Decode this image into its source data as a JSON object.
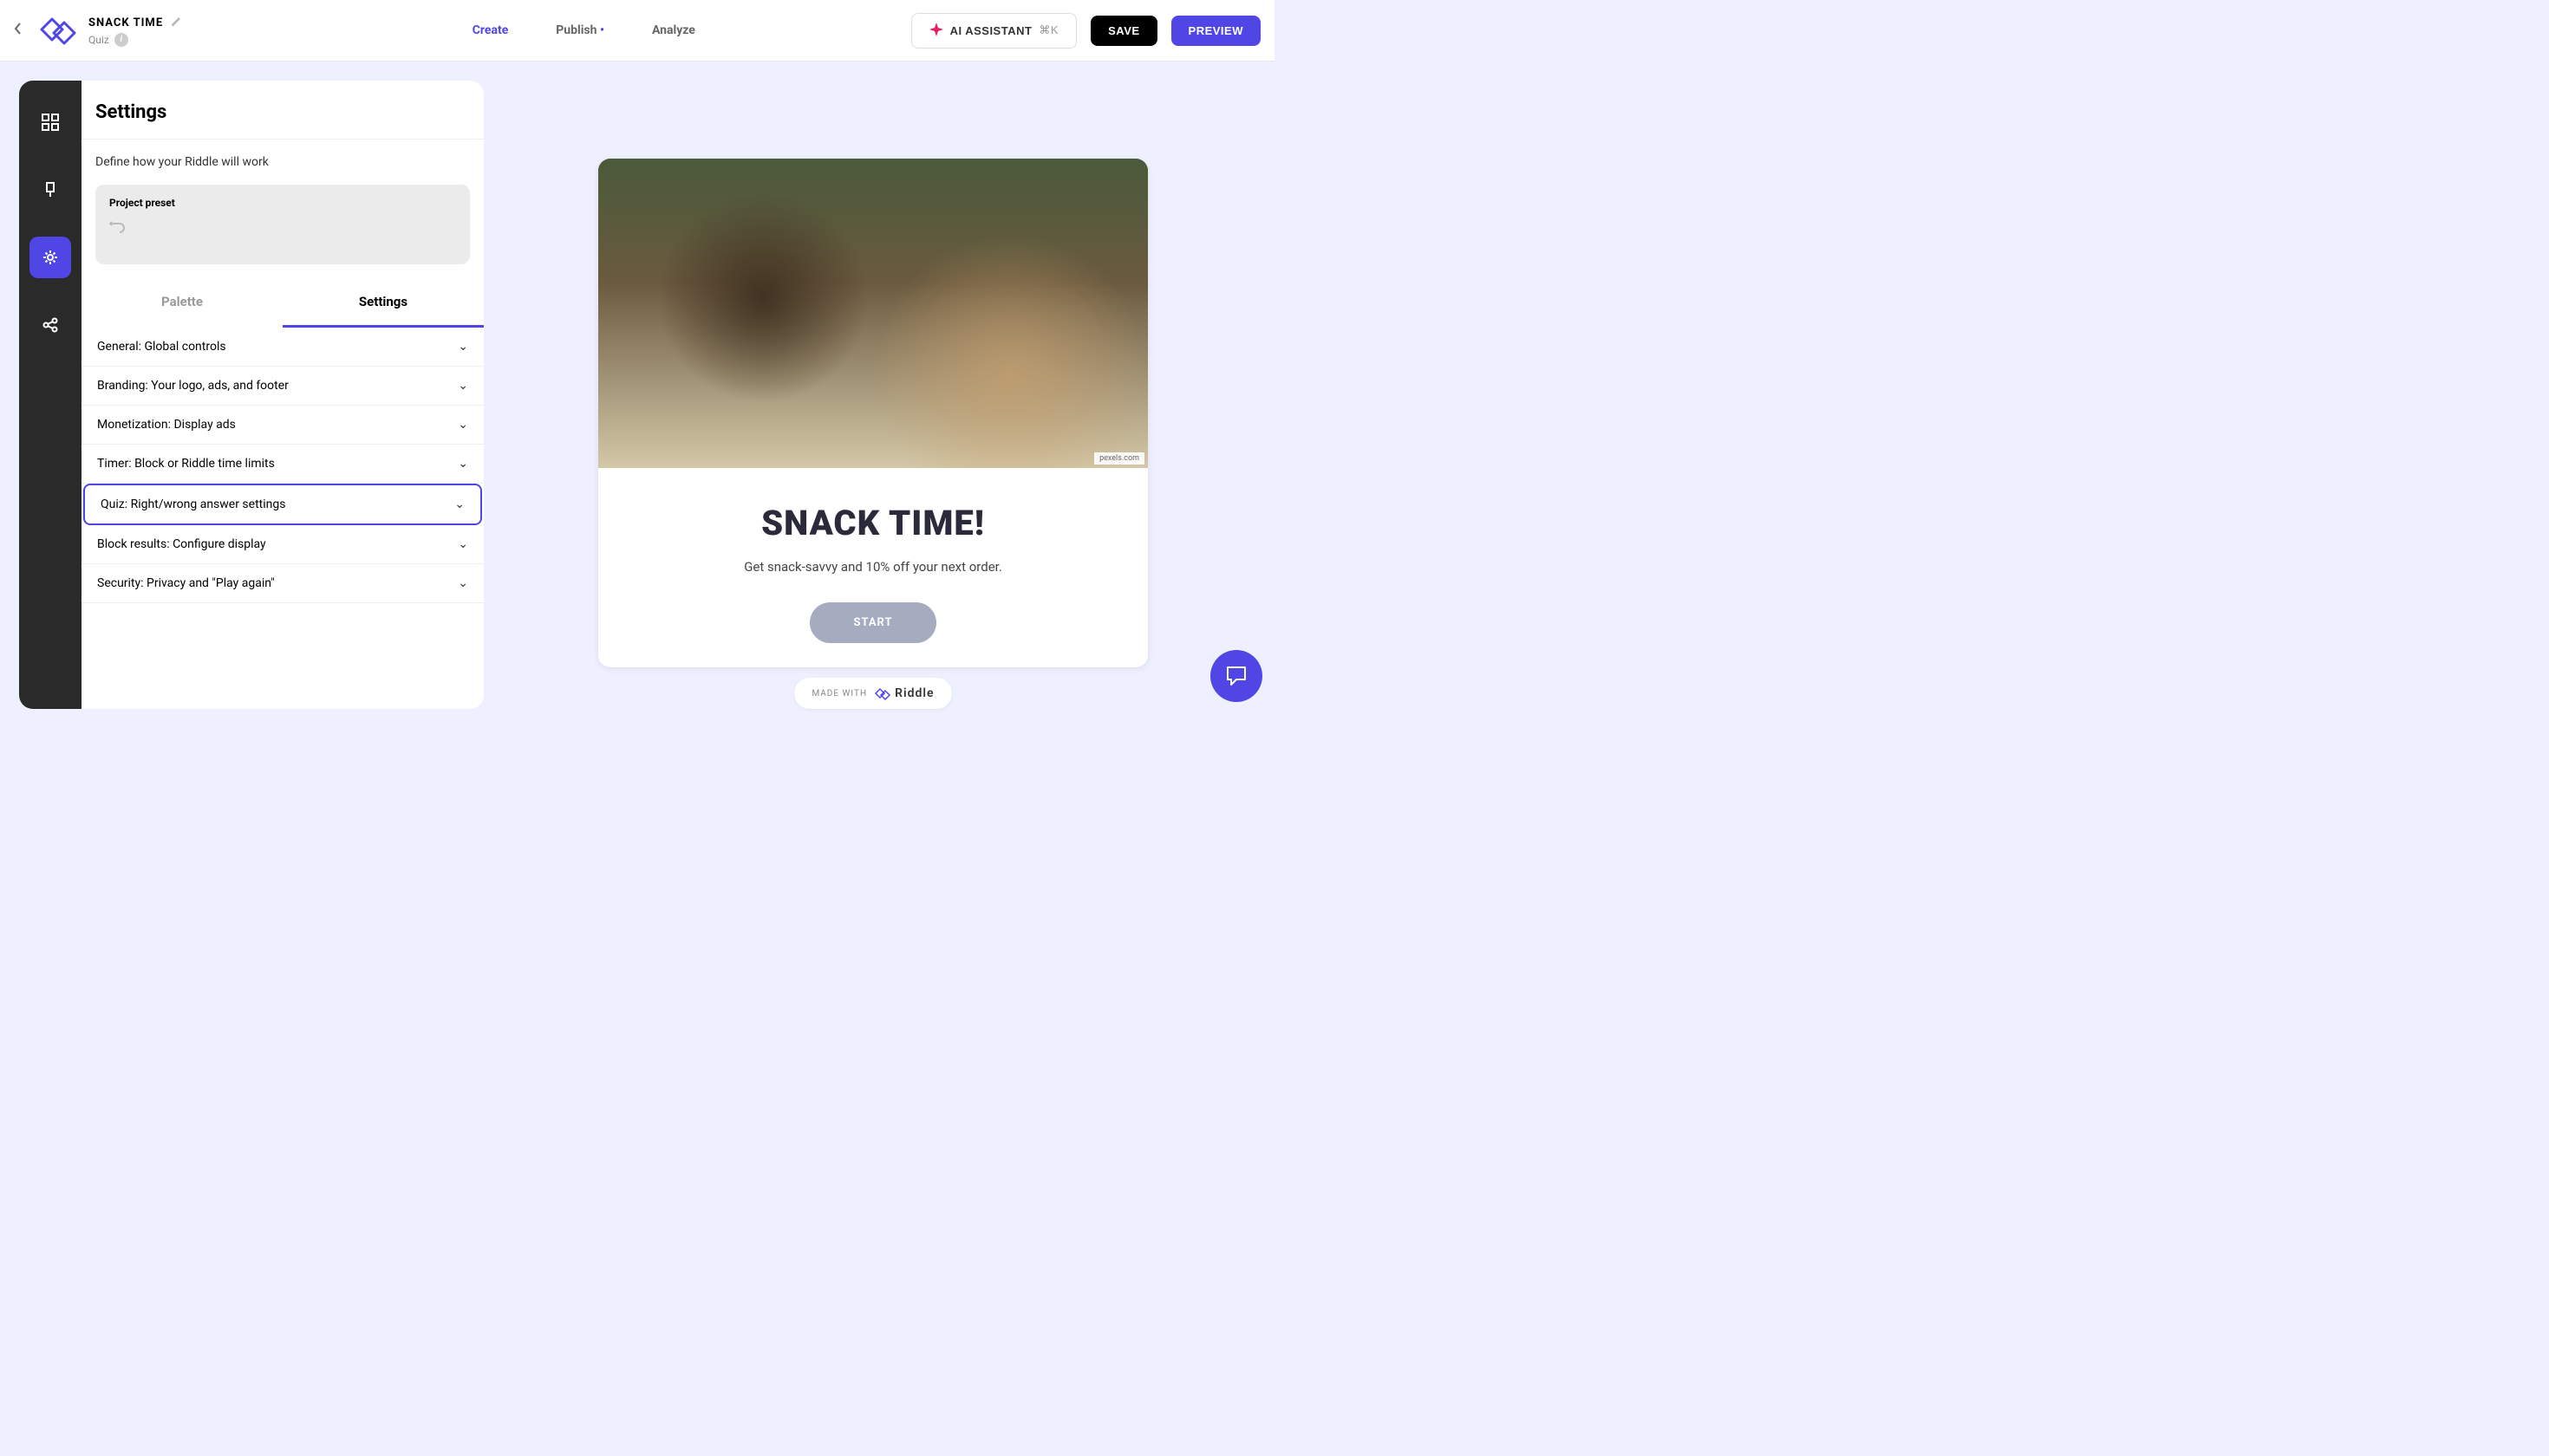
{
  "header": {
    "project_title": "SNACK TIME",
    "project_type": "Quiz",
    "nav": {
      "create": "Create",
      "publish": "Publish",
      "analyze": "Analyze"
    },
    "ai_button": "AI ASSISTANT",
    "ai_shortcut": "⌘K",
    "save": "SAVE",
    "preview": "PREVIEW"
  },
  "settings": {
    "title": "Settings",
    "description": "Define how your Riddle will work",
    "preset_label": "Project preset",
    "tabs": {
      "palette": "Palette",
      "settings": "Settings"
    },
    "accordion": [
      "General: Global controls",
      "Branding: Your logo, ads, and footer",
      "Monetization: Display ads",
      "Timer: Block or Riddle time limits",
      "Quiz: Right/wrong answer settings",
      "Block results: Configure display",
      "Security: Privacy and \"Play again\""
    ]
  },
  "preview": {
    "image_credit": "pexels.com",
    "title": "SNACK TIME!",
    "subtitle": "Get snack-savvy and 10% off your next order.",
    "start": "START",
    "made_with": "MADE WITH",
    "brand": "Riddle"
  }
}
